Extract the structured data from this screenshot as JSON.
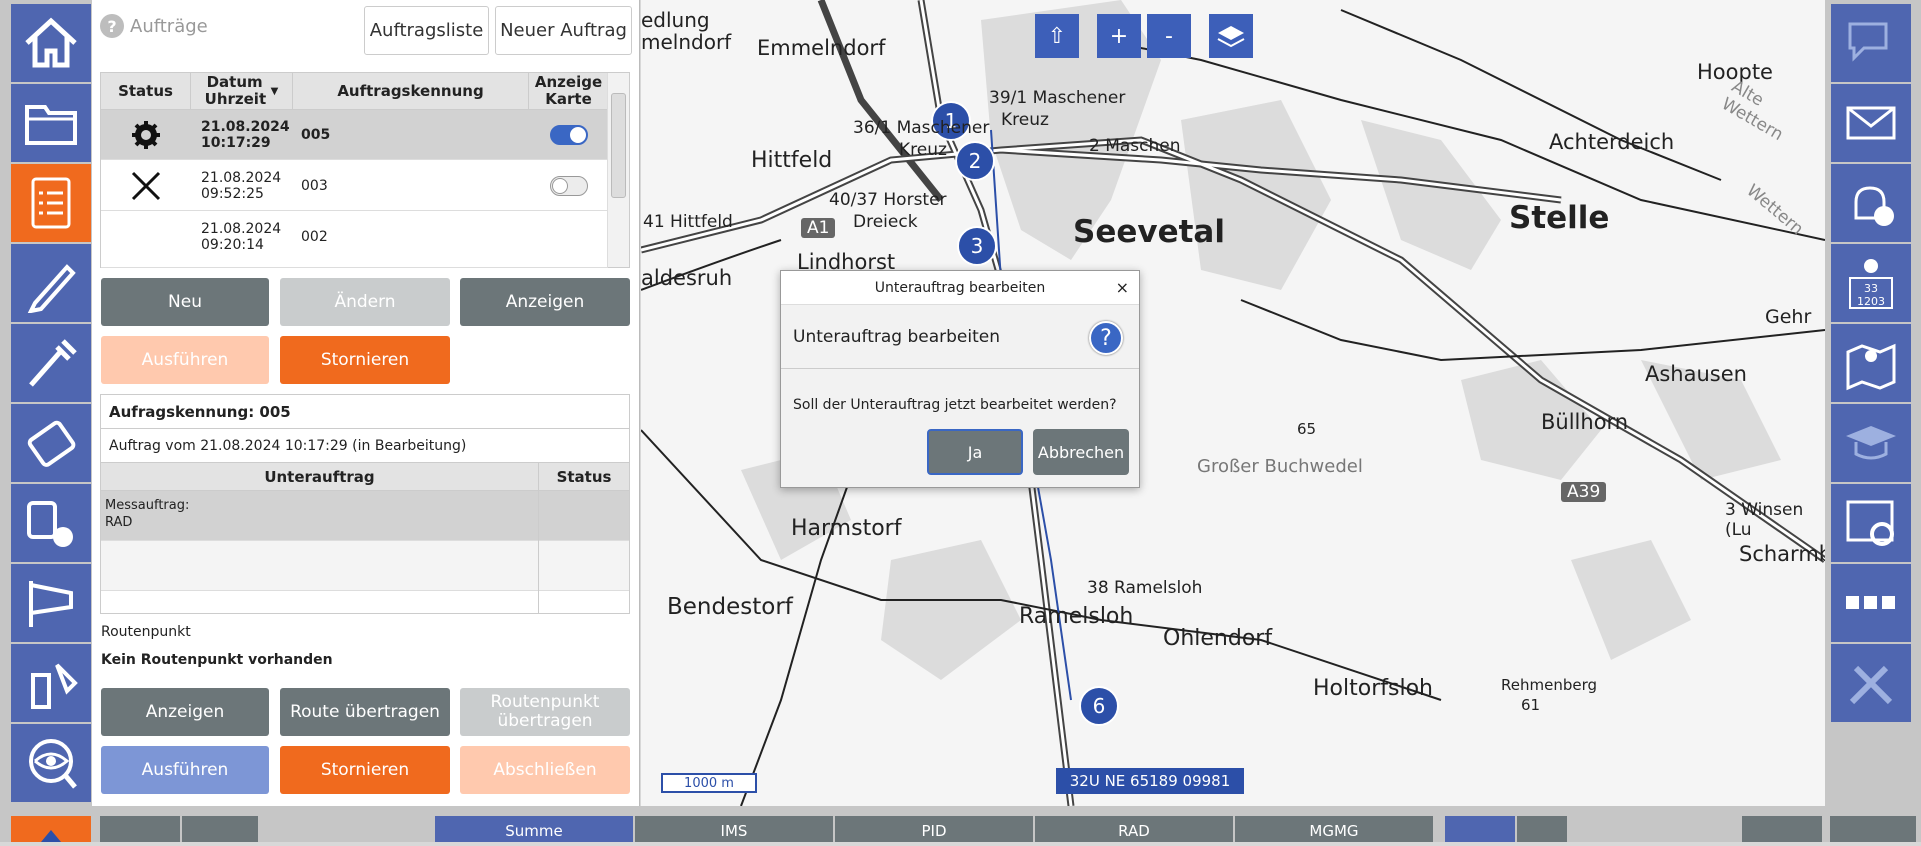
{
  "left_nav": {
    "active_index": 2,
    "items": [
      "home",
      "folder",
      "orders",
      "pen",
      "probe",
      "device",
      "radiation",
      "windsock",
      "sampling",
      "view"
    ]
  },
  "panel": {
    "title": "Aufträge",
    "btn_list": "Auftragsliste",
    "btn_new": "Neuer Auftrag",
    "table": {
      "headers": {
        "status": "Status",
        "datum": "Datum Uhrzeit",
        "sort": "▼",
        "kennung": "Auftragskennung",
        "karte": "Anzeige Karte"
      },
      "rows": [
        {
          "status_icon": "gear-icon",
          "date": "21.08.2024",
          "time": "10:17:29",
          "id": "005",
          "map_on": true
        },
        {
          "status_icon": "close-icon",
          "date": "21.08.2024",
          "time": "09:52:25",
          "id": "003",
          "map_on": false
        },
        {
          "status_icon": "",
          "date": "21.08.2024",
          "time": "09:20:14",
          "id": "002",
          "map_on": null
        }
      ]
    },
    "buttons_row1": {
      "neu": "Neu",
      "aendern": "Ändern",
      "anzeigen": "Anzeigen"
    },
    "buttons_row2": {
      "ausfuehren": "Ausführen",
      "stornieren": "Stornieren"
    },
    "detail": {
      "kennung": "Aufragskennung: 005",
      "info": "Auftrag vom 21.08.2024 10:17:29 (in Bearbeitung)",
      "col_unterauftrag": "Unterauftrag",
      "col_status": "Status",
      "row1_line1": "Messauftrag:",
      "row1_line2": "RAD"
    },
    "routenpunkt_label": "Routenpunkt",
    "routenpunkt_value": "Kein Routenpunkt vorhanden",
    "route_btns": {
      "anzeigen": "Anzeigen",
      "route": "Route übertragen",
      "routenpunkt": "Routenpunkt übertragen",
      "ausfuehren": "Ausführen",
      "stornieren": "Stornieren",
      "abschliessen": "Abschließen"
    }
  },
  "map": {
    "controls": {
      "up": "⇧",
      "plus": "+",
      "minus": "-"
    },
    "markers": [
      "1",
      "2",
      "3",
      "6"
    ],
    "scale": "1000 m",
    "coordinate": "32U NE 65189 09981",
    "labels": {
      "emmelndorf": "Emmelndorf",
      "hittfeld": "Hittfeld",
      "seevetal": "Seevetal",
      "stelle": "Stelle",
      "lindhorst": "Lindhorst",
      "achterdeich": "Achterdeich",
      "hoopte": "Hoopte",
      "ashausen": "Ashausen",
      "buellhorn": "Büllhorn",
      "harmstorf": "Harmstorf",
      "bendestorf": "Bendestorf",
      "ramelsloh": "Ramelsloh",
      "ohlendorf": "Ohlendorf",
      "holtorfsloh": "Holtorfsloh",
      "buchwedel": "Großer Buchwedel",
      "maschener": "39/1 Maschener",
      "kreuz1": "Kreuz",
      "maschen": "2 Maschen",
      "mas36": "36/1 Maschener",
      "kreuz2": "Kreuz",
      "horster": "40/37 Horster",
      "dreieck": "Dreieck",
      "hittfeld41": "41 Hittfeld",
      "a1": "A1",
      "a39": "A39",
      "ramelsloh38": "38 Ramelsloh",
      "winsen": "3 Winsen (Lu",
      "scharmb": "Scharmb",
      "gehr": "Gehr",
      "rehmenberg": "Rehmenberg",
      "r61": "61",
      "h65": "65",
      "aldesruh": "aldesruh",
      "edlung": "edlung",
      "melndorf": "melndorf",
      "alte": "Alte Wettern",
      "wettern": "Wettern"
    }
  },
  "dialog": {
    "title": "Unterauftrag bearbeiten",
    "header": "Unterauftrag bearbeiten",
    "question": "Soll der Unterauftrag jetzt bearbeitet werden?",
    "yes": "Ja",
    "cancel": "Abbrechen",
    "close": "×"
  },
  "right_nav": {
    "items": [
      "chat",
      "mail",
      "alarm-clock",
      "info-counter",
      "map-pin",
      "graduation",
      "settings-window",
      "more",
      "tools"
    ],
    "counter_a": "33",
    "counter_b": "1203"
  },
  "bottom": {
    "tabs": [
      "Summe",
      "IMS",
      "PID",
      "RAD",
      "MGMG"
    ]
  }
}
